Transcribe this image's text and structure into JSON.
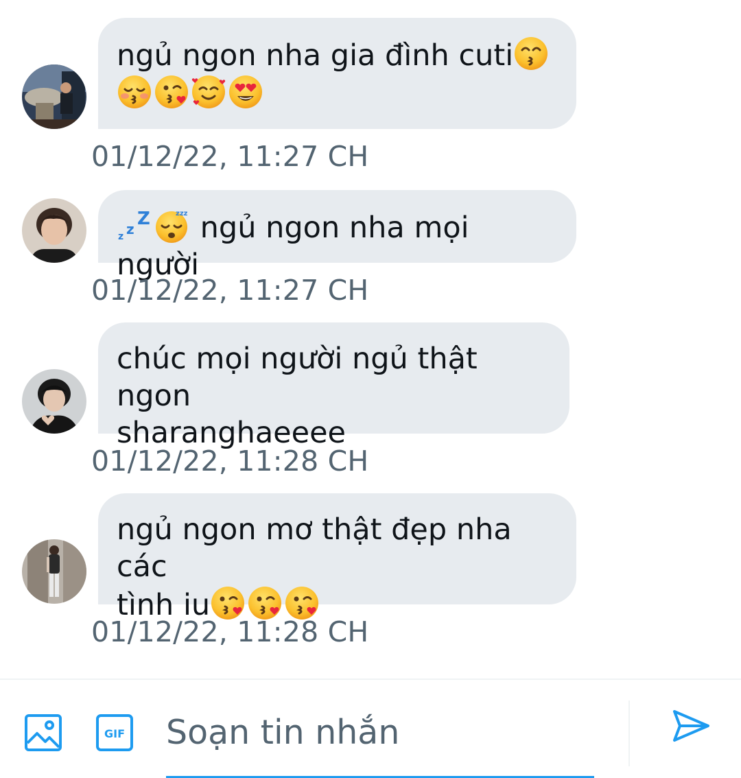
{
  "colors": {
    "accent": "#1d9bf0",
    "bubble_bg": "#e7ebef",
    "timestamp": "#536471",
    "text": "#0f1419"
  },
  "messages": [
    {
      "avatar": "user-avatar-icon",
      "text_line1": "ngủ ngon nha gia đình cuti",
      "emojis_line1": [
        "kissing-smiling-eyes-emoji"
      ],
      "text_line2": "",
      "emojis_line2": [
        "kissing-closed-eyes-emoji",
        "face-blowing-kiss-emoji",
        "smiling-face-with-hearts-emoji",
        "heart-eyes-emoji"
      ],
      "timestamp": "01/12/22, 11:27 CH"
    },
    {
      "avatar": "user-avatar-icon",
      "text_line1": " ngủ ngon nha mọi người",
      "emojis_line1": [
        "zzz-emoji",
        "sleeping-face-emoji"
      ],
      "timestamp": "01/12/22, 11:27 CH"
    },
    {
      "avatar": "user-avatar-icon",
      "text_line1": "chúc mọi người ngủ thật ngon",
      "text_line2": "sharanghaeeee",
      "timestamp": "01/12/22, 11:28 CH"
    },
    {
      "avatar": "user-avatar-icon",
      "text_line1": "ngủ ngon mơ thật đẹp nha các",
      "text_line2": "tình iu",
      "emojis_line2": [
        "face-blowing-kiss-emoji",
        "face-blowing-kiss-emoji",
        "face-blowing-kiss-emoji"
      ],
      "timestamp": "01/12/22, 11:28 CH"
    }
  ],
  "composer": {
    "placeholder": "Soạn tin nhắn",
    "value": "",
    "media_icon": "image-icon",
    "gif_icon": "gif-icon",
    "gif_label": "GIF",
    "send_icon": "send-icon"
  }
}
